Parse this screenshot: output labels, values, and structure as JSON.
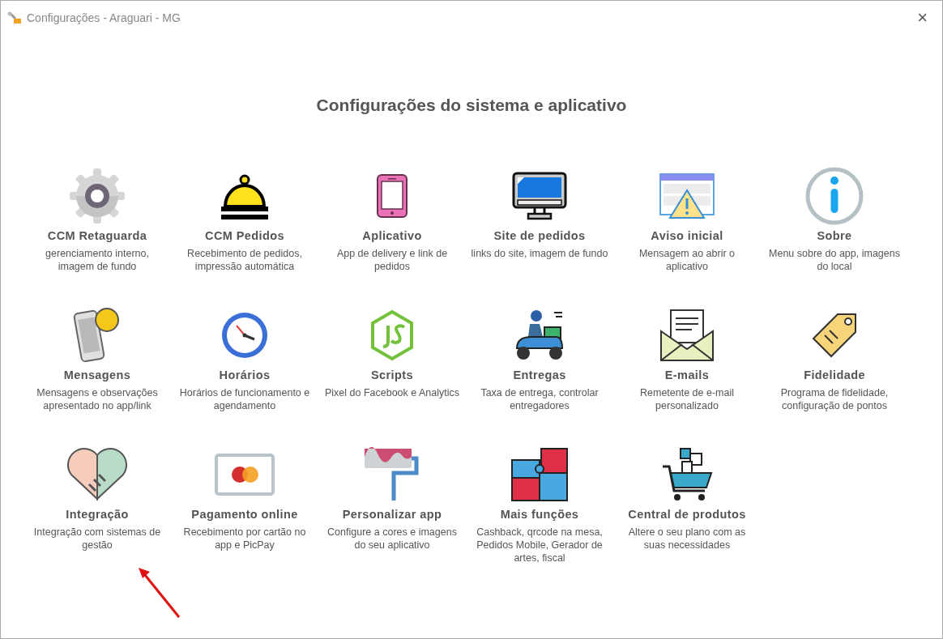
{
  "window": {
    "title": "Configurações - Araguari - MG",
    "close": "×"
  },
  "heading": "Configurações do sistema e aplicativo",
  "items": [
    {
      "title": "CCM Retaguarda",
      "description": "gerenciamento interno, imagem de fundo"
    },
    {
      "title": "CCM Pedidos",
      "description": "Recebimento de pedidos, impressão automática"
    },
    {
      "title": "Aplicativo",
      "description": "App de delivery e link de pedidos"
    },
    {
      "title": "Site de pedidos",
      "description": "links do site, imagem de fundo"
    },
    {
      "title": "Aviso inicial",
      "description": "Mensagem ao abrir o aplicativo"
    },
    {
      "title": "Sobre",
      "description": "Menu sobre do app, imagens do local"
    },
    {
      "title": "Mensagens",
      "description": "Mensagens e observações apresentado no app/link"
    },
    {
      "title": "Horários",
      "description": "Horários de funcionamento e agendamento"
    },
    {
      "title": "Scripts",
      "description": "Pixel do Facebook e Analytics"
    },
    {
      "title": "Entregas",
      "description": "Taxa de entrega, controlar entregadores"
    },
    {
      "title": "E-mails",
      "description": "Remetente de e-mail personalizado"
    },
    {
      "title": "Fidelidade",
      "description": "Programa de fidelidade, configuração de pontos"
    },
    {
      "title": "Integração",
      "description": "Integração com sistemas de gestão"
    },
    {
      "title": "Pagamento online",
      "description": "Recebimento por cartão no app e PicPay"
    },
    {
      "title": "Personalizar app",
      "description": "Configure a cores e imagens do seu aplicativo"
    },
    {
      "title": "Mais funções",
      "description": "Cashback, qrcode na mesa, Pedidos Mobile, Gerador de artes, fiscal"
    },
    {
      "title": "Central de produtos",
      "description": "Altere o seu plano com as suas necessidades"
    }
  ]
}
